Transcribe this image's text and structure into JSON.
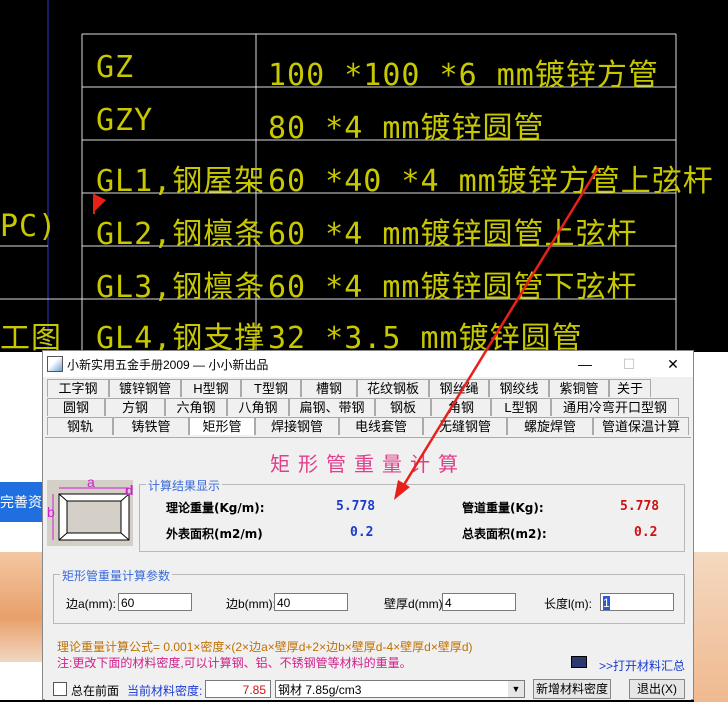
{
  "cad": {
    "rows": [
      {
        "code": "GZ",
        "desc": "100 *100 *6 mm镀锌方管"
      },
      {
        "code": "GZY",
        "desc": "80 *4 mm镀锌圆管"
      },
      {
        "code": "GL1,钢屋架",
        "desc": "60 *40 *4 mm镀锌方管上弦杆"
      },
      {
        "code": "GL2,钢檩条",
        "desc": "60 *4 mm镀锌圆管上弦杆"
      },
      {
        "code": "GL3,钢檩条",
        "desc": "60 *4 mm镀锌圆管下弦杆"
      },
      {
        "code": "GL4,钢支撑",
        "desc": "32 *3.5 mm镀锌圆管"
      }
    ],
    "left_fragment_1": "PC)",
    "left_fragment_2": "工图"
  },
  "web": {
    "button_fragment": "完善资"
  },
  "window": {
    "title": "小新实用五金手册2009 — 小小新出品",
    "tabs_row1": [
      "工字钢",
      "镀锌钢管",
      "H型钢",
      "T型钢",
      "槽钢",
      "花纹钢板",
      "钢丝绳",
      "钢绞线",
      "紫铜管",
      "关于"
    ],
    "tabs_row2": [
      "圆钢",
      "方钢",
      "六角钢",
      "八角钢",
      "扁钢、带钢",
      "钢板",
      "角钢",
      "L型钢",
      "通用冷弯开口型钢"
    ],
    "tabs_row3": [
      "钢轨",
      "铸铁管",
      "矩形管",
      "焊接钢管",
      "电线套管",
      "无缝钢管",
      "螺旋焊管",
      "管道保温计算"
    ],
    "active_tab": "矩形管",
    "heading": "矩形管重量计算",
    "diagram": {
      "a": "a",
      "b": "b",
      "d": "d"
    },
    "results": {
      "legend": "计算结果显示",
      "theory_weight_label": "理论重量(Kg/m):",
      "theory_weight_value": "5.778",
      "pipe_weight_label": "管道重量(Kg):",
      "pipe_weight_value": "5.778",
      "outer_area_label": "外表面积(m2/m)",
      "outer_area_value": "0.2",
      "total_area_label": "总表面积(m2):",
      "total_area_value": "0.2"
    },
    "params": {
      "legend": "矩形管重量计算参数",
      "side_a_label": "边a(mm):",
      "side_a_value": "60",
      "side_b_label": "边b(mm):",
      "side_b_value": "40",
      "wall_label": "壁厚d(mm)",
      "wall_value": "4",
      "length_label": "长度l(m):",
      "length_value": "1"
    },
    "formula": "理论重量计算公式= 0.001×密度×(2×边a×壁厚d+2×边b×壁厚d-4×壁厚d×壁厚d)",
    "note": "注:更改下面的材料密度,可以计算钢、铝、不锈钢管等材料的重量。",
    "open_summary": ">>打开材料汇总",
    "bottom": {
      "always_on_top": "总在前面",
      "density_label": "当前材料密度:",
      "density_value": "7.85",
      "material_select": "钢材 7.85g/cm3",
      "add_material": "新增材料密度",
      "exit": "退出(X)"
    }
  },
  "colors": {
    "cad_text": "#c8c800",
    "heading": "#e0408a",
    "value_blue": "#1a3ad0",
    "value_red": "#d01010",
    "arrow": "#e8201a"
  }
}
